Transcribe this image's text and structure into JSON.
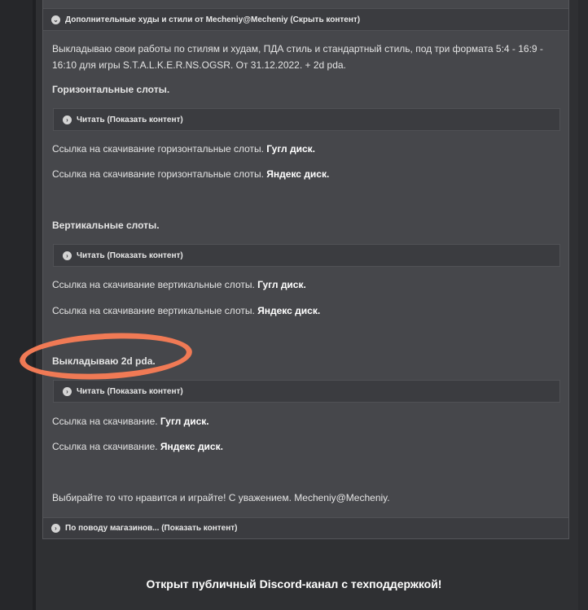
{
  "post": {
    "top_spoiler": "Дополнительные худы и стили от Mecheniy@Mecheniy (Скрыть контент)",
    "intro": "Выкладываю свои работы по стилям и худам, ПДА стиль и стандартный стиль, под три формата 5:4 - 16:9 - 16:10 для игры S.T.A.L.K.E.R.NS.OGSR. От 31.12.2022.  + 2d pda.",
    "sections": [
      {
        "heading": "Горизонтальные слоты.",
        "spoiler": "Читать (Показать контент)",
        "links": [
          {
            "text": "Ссылка на скачивание горизонтальные слоты. ",
            "link": "Гугл диск."
          },
          {
            "text": "Ссылка на скачивание горизонтальные слоты. ",
            "link": "Яндекс диск."
          }
        ]
      },
      {
        "heading": "Вертикальные слоты.",
        "spoiler": "Читать (Показать контент)",
        "links": [
          {
            "text": "Ссылка на скачивание вертикальные слоты. ",
            "link": "Гугл диск."
          },
          {
            "text": "Ссылка на скачивание вертикальные слоты. ",
            "link": "Яндекс диск."
          }
        ]
      },
      {
        "heading": "Выкладываю 2d pda.",
        "spoiler": "Читать (Показать контент)",
        "links": [
          {
            "text": "Ссылка на скачивание. ",
            "link": "Гугл диск."
          },
          {
            "text": "Ссылка на скачивание. ",
            "link": "Яндекс диск."
          }
        ]
      }
    ],
    "closing": "Выбирайте то что нравится и играйте! С уважением. Mecheniy@Mecheniy.",
    "bottom_spoiler": "По поводу магазинов... (Показать контент)"
  },
  "footer": {
    "title": "Открыт публичный Discord-канал с техподдержкой!"
  },
  "icons": {
    "spoiler": "chevron-right-circle-icon"
  },
  "colors": {
    "highlight": "#f07a55"
  }
}
